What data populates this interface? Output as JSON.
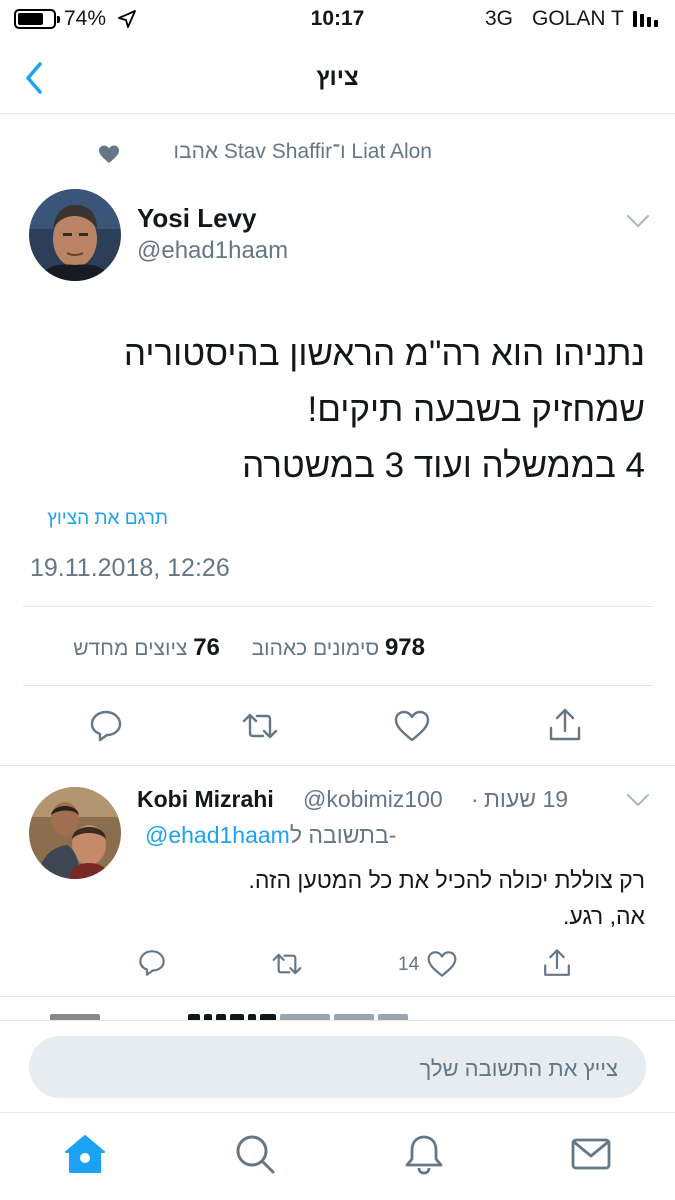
{
  "status_bar": {
    "battery_percent": "74%",
    "battery_level": 0.74,
    "time": "10:17",
    "network": "3G",
    "carrier": "GOLAN T"
  },
  "nav": {
    "title": "ציוץ"
  },
  "liked_by": {
    "text": "Liat Alon ו־Stav Shaffir אהבו"
  },
  "tweet": {
    "author_name": "Yosi Levy",
    "author_handle": "@ehad1haam",
    "lines": [
      "נתניהו הוא רה\"מ הראשון בהיסטוריה",
      "שמחזיק בשבעה תיקים!",
      "4 בממשלה ועוד 3 במשטרה"
    ],
    "translate_label": "תרגם את הציוץ",
    "timestamp": "19.11.2018, 12:26",
    "likes_count": "978",
    "likes_label": "סימונים כאהוב",
    "retweets_count": "76",
    "retweets_label": "ציוצים מחדש"
  },
  "reply": {
    "author_name": "Kobi Mizrahi",
    "author_handle": "@kobimiz100",
    "separator": "·",
    "time_ago": "19 שעות",
    "replying_to_label": "בתשובה ל-",
    "replying_to_handle": "@ehad1haam",
    "lines": [
      "רק צוללת יכולה להכיל את כל המטען הזה.",
      "אה, רגע."
    ],
    "like_count": "14"
  },
  "compose": {
    "placeholder": "צייץ את התשובה שלך"
  },
  "colors": {
    "accent": "#1da1f2",
    "secondary_text": "#657786",
    "divider": "#e1e8ed",
    "compose_bg": "#e6ecf0"
  },
  "icons": {
    "back": "chevron-left-icon",
    "reply": "speech-bubble-icon",
    "retweet": "retweet-arrows-icon",
    "like": "heart-icon",
    "share": "share-upload-icon",
    "home": "home-icon",
    "search": "search-icon",
    "notifications": "bell-icon",
    "messages": "envelope-icon"
  }
}
